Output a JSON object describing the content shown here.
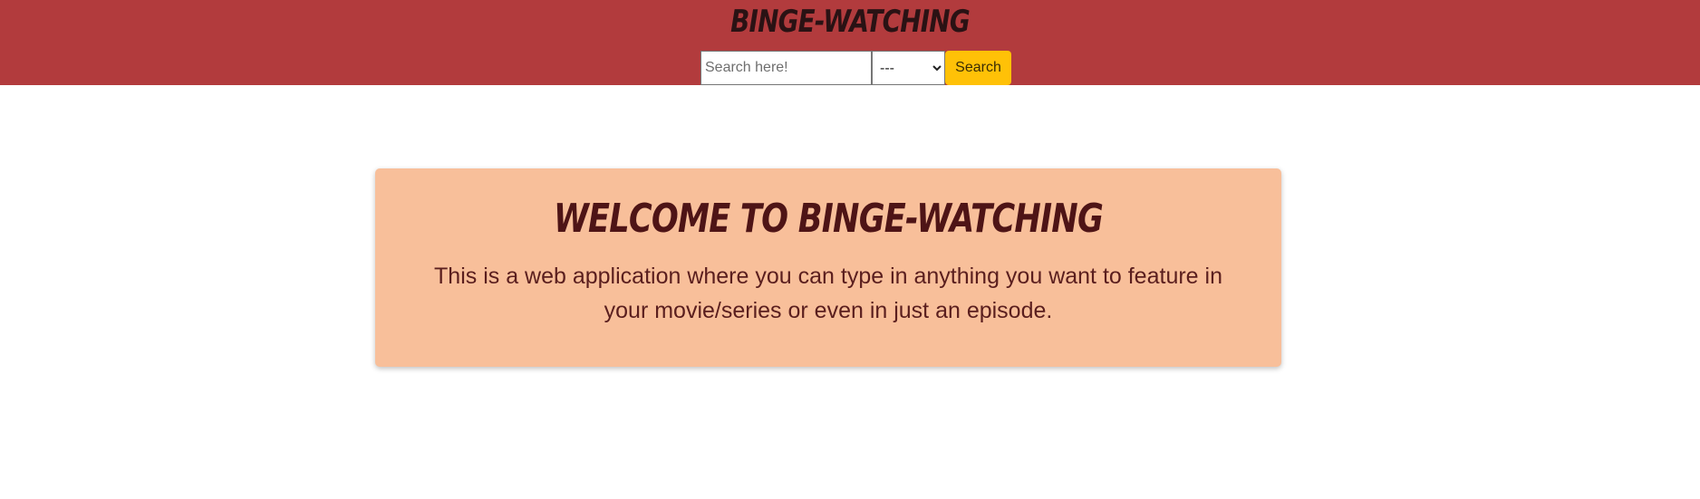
{
  "header": {
    "brand": "BINGE-WATCHING",
    "search": {
      "placeholder": "Search here!",
      "value": "",
      "type_options": [
        "---"
      ],
      "selected_type": "---",
      "button_label": "Search"
    }
  },
  "main": {
    "title": "WELCOME TO BINGE-WATCHING",
    "description": "This is a web application where you can type in anything you want to feature in your movie/series or even in just an episode."
  },
  "colors": {
    "header_bg": "#b23b3d",
    "card_bg": "#f8bf9a",
    "button_bg": "#ffc107",
    "title_text": "#4e1416"
  }
}
